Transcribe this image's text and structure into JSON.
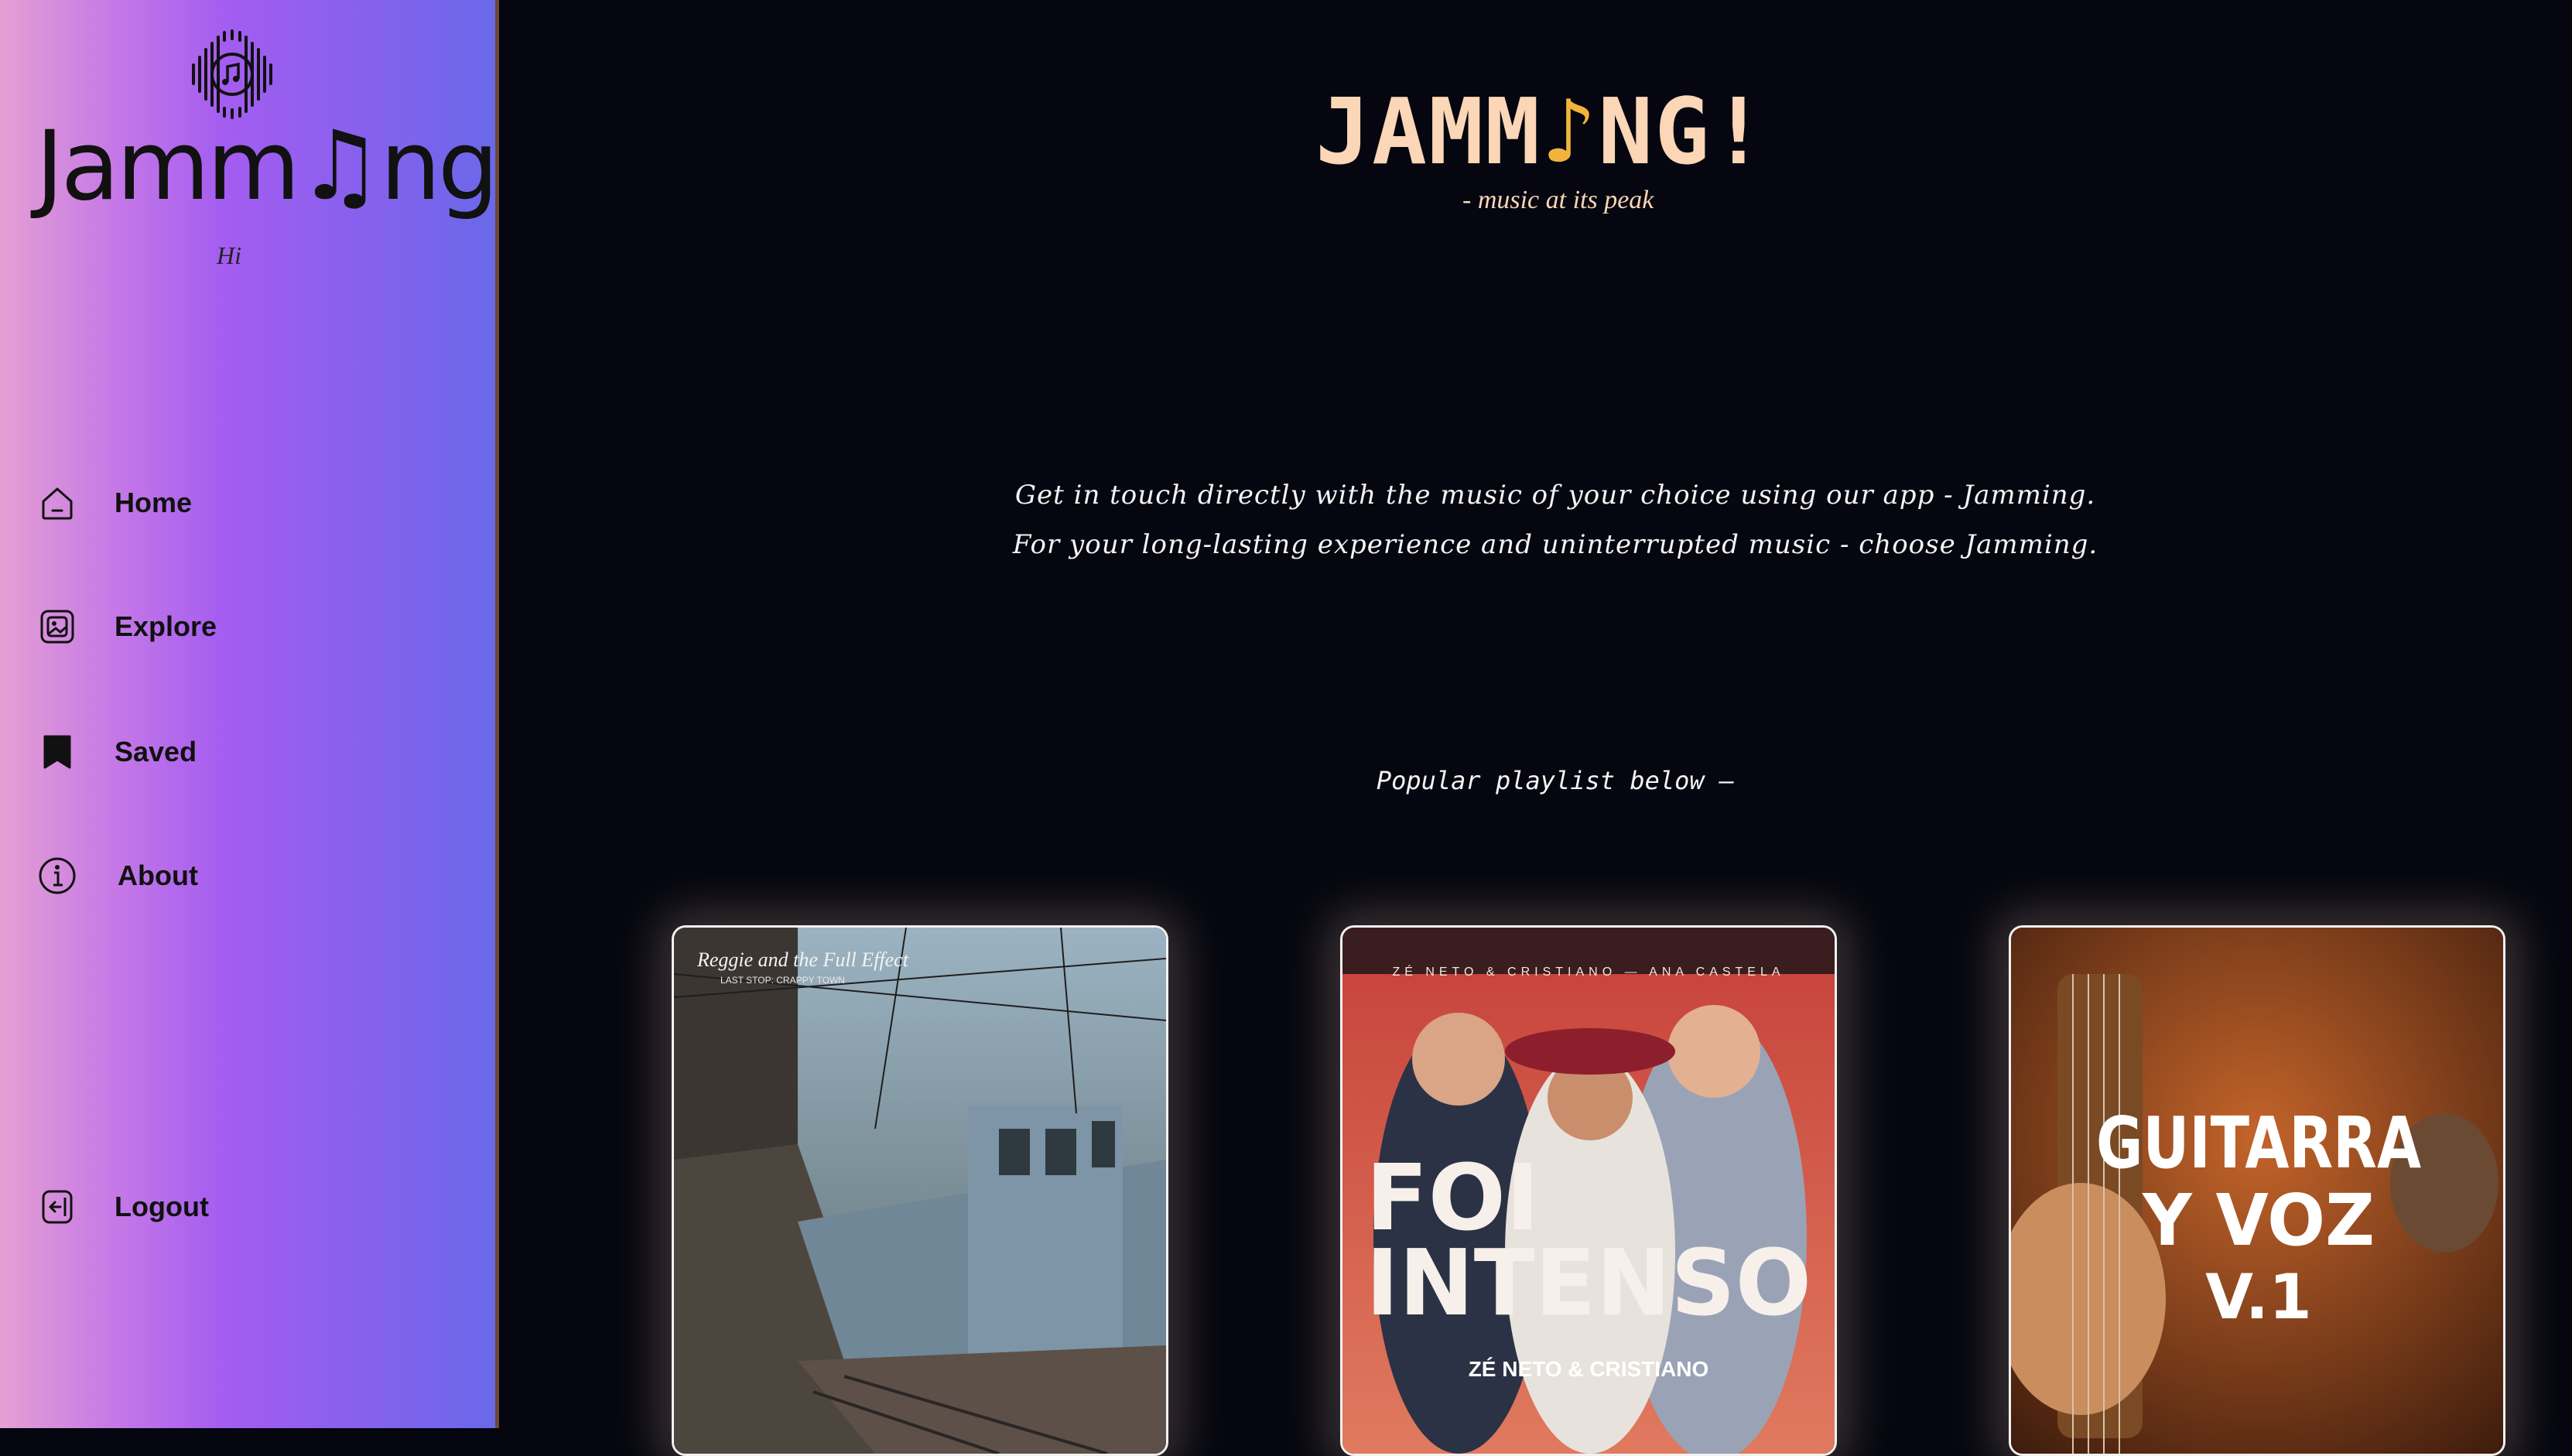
{
  "sidebar": {
    "brand": "Jamm♫ng",
    "greeting": "Hi",
    "nav": [
      {
        "label": "Home",
        "icon": "home-icon"
      },
      {
        "label": "Explore",
        "icon": "image-gallery-icon"
      },
      {
        "label": "Saved",
        "icon": "bookmark-icon"
      },
      {
        "label": "About",
        "icon": "info-icon"
      }
    ],
    "logout": {
      "label": "Logout",
      "icon": "logout-icon"
    },
    "logo_icon": "music-soundwave-icon"
  },
  "header": {
    "title_before": "JAMM",
    "title_note": "♪",
    "title_after": "NG!",
    "tagline": "- music at its peak"
  },
  "main": {
    "description": "Get in touch directly with the music of your choice using our app - Jamming. For your long-lasting experience and uninterrupted music - choose Jamming.",
    "popular_label": "Popular playlist below –"
  },
  "playlists": [
    {
      "cover_title": "Reggie and the Full Effect",
      "cover_subtitle": "LAST STOP: CRAPPY TOWN"
    },
    {
      "cover_artists": "ZÉ NETO & CRISTIANO — ANA CASTELA",
      "cover_title_line1": "FOI",
      "cover_title_line2": "INTENSO",
      "cover_logo": "ZÉ NETO & CRISTIANO"
    },
    {
      "cover_title_line1": "GUITARRA",
      "cover_title_line2": "Y VOZ",
      "cover_title_line3": "V.1"
    }
  ],
  "colors": {
    "background": "#05060f",
    "title": "#fbd6b7",
    "note_accent": "#f0b43c",
    "sidebar_start": "#e5a0d3",
    "sidebar_end": "#6a68ea"
  }
}
